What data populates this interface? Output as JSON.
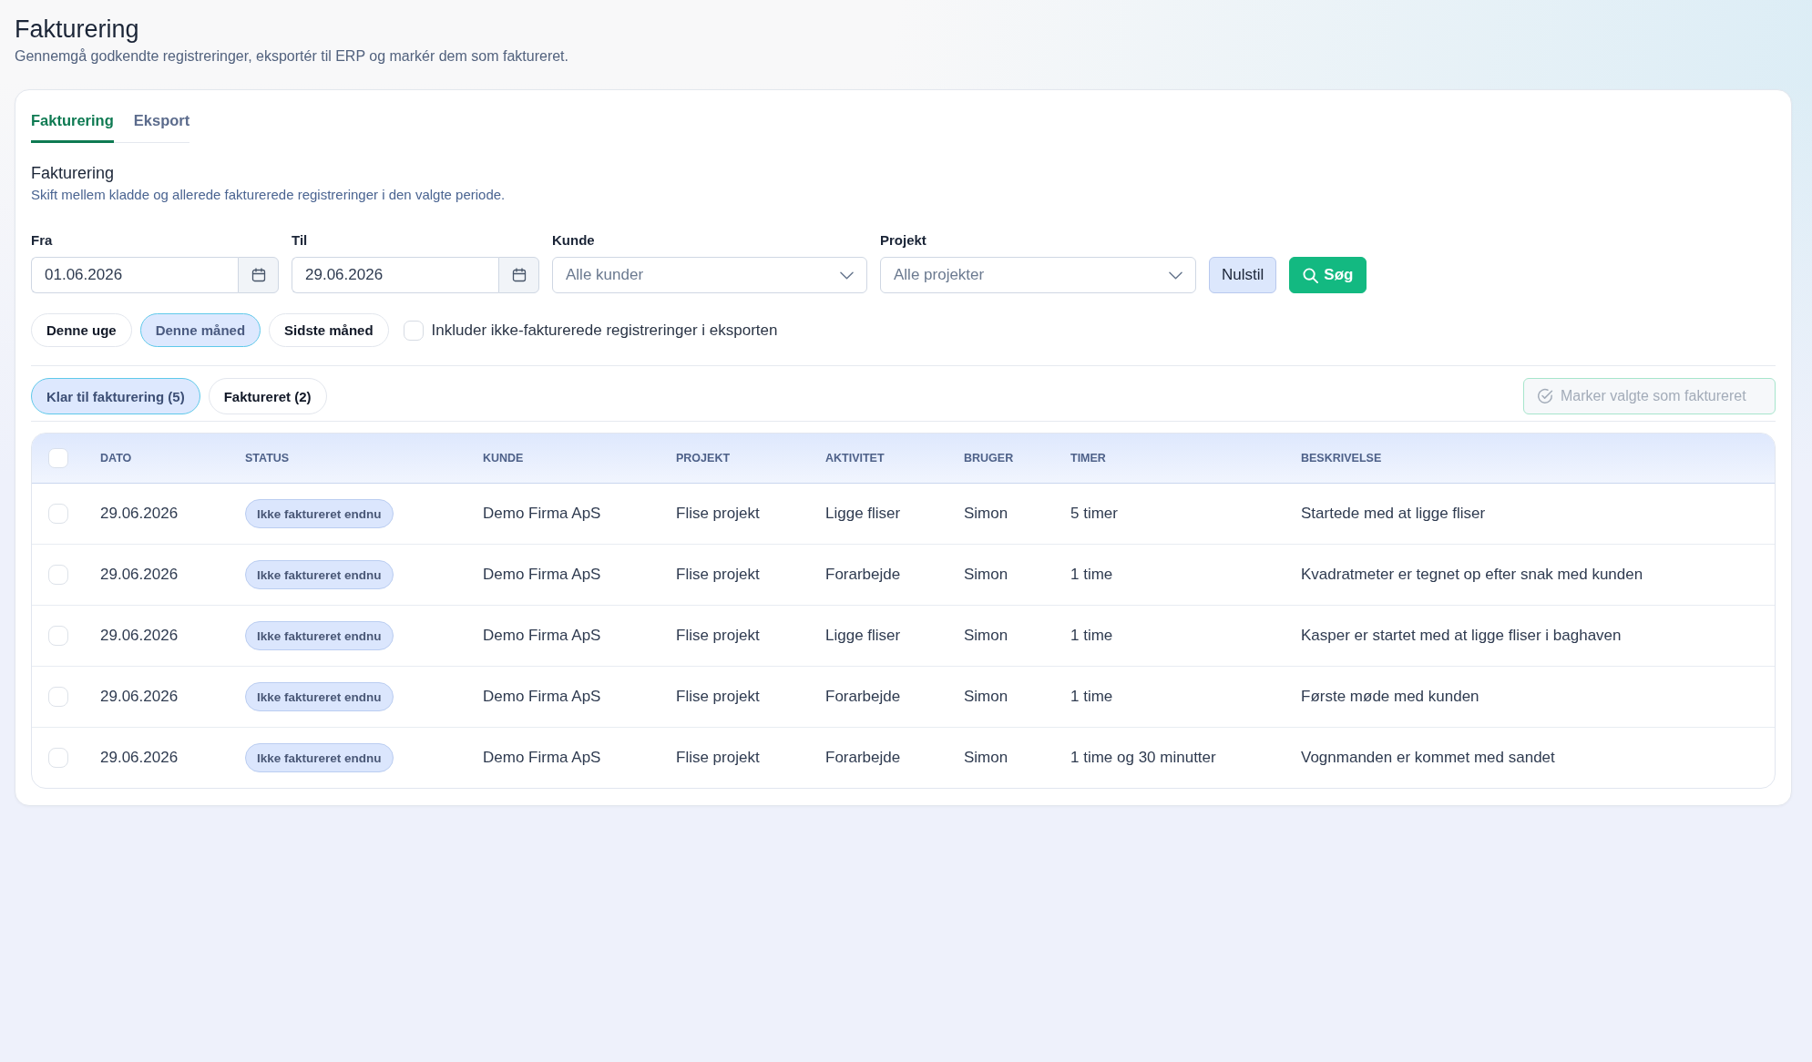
{
  "page": {
    "title": "Fakturering",
    "subtitle": "Gennemgå godkendte registreringer, eksportér til ERP og markér dem som faktureret."
  },
  "tabs": [
    {
      "label": "Fakturering",
      "selected": true
    },
    {
      "label": "Eksport",
      "selected": false
    }
  ],
  "section": {
    "title": "Fakturering",
    "subtitle": "Skift mellem kladde og allerede fakturerede registreringer i den valgte periode."
  },
  "filters": {
    "fields": [
      {
        "kind": "date",
        "label": "Fra",
        "value": "01.06.2026"
      },
      {
        "kind": "date",
        "label": "Til",
        "value": "29.06.2026"
      },
      {
        "kind": "select",
        "label": "Kunde",
        "placeholder": "Alle kunder"
      },
      {
        "kind": "select",
        "label": "Projekt",
        "placeholder": "Alle projekter"
      }
    ],
    "buttons": [
      {
        "kind": "reset",
        "label": "Nulstil"
      },
      {
        "kind": "search",
        "label": "Søg"
      }
    ]
  },
  "presets": [
    {
      "label": "Denne uge",
      "selected": false
    },
    {
      "label": "Denne måned",
      "selected": true
    },
    {
      "label": "Sidste måned",
      "selected": false
    }
  ],
  "include_option": {
    "label": "Inkluder ikke-fakturerede registreringer i eksporten",
    "checked": false
  },
  "status_tabs": [
    {
      "label": "Klar til fakturering (5)",
      "selected": true
    },
    {
      "label": "Faktureret (2)",
      "selected": false
    }
  ],
  "mark_button": {
    "label": "Marker valgte som faktureret",
    "disabled": true
  },
  "table": {
    "select_all": {
      "checked": false
    },
    "columns": [
      "DATO",
      "STATUS",
      "KUNDE",
      "PROJEKT",
      "AKTIVITET",
      "BRUGER",
      "TIMER",
      "BESKRIVELSE"
    ],
    "rows": [
      {
        "checked": false,
        "date": "29.06.2026",
        "status": "Ikke faktureret endnu",
        "customer": "Demo Firma ApS",
        "project": "Flise projekt",
        "activity": "Ligge fliser",
        "user": "Simon",
        "hours": "5 timer",
        "description": "Startede med at ligge fliser"
      },
      {
        "checked": false,
        "date": "29.06.2026",
        "status": "Ikke faktureret endnu",
        "customer": "Demo Firma ApS",
        "project": "Flise projekt",
        "activity": "Forarbejde",
        "user": "Simon",
        "hours": "1 time",
        "description": "Kvadratmeter er tegnet op efter snak med kunden"
      },
      {
        "checked": false,
        "date": "29.06.2026",
        "status": "Ikke faktureret endnu",
        "customer": "Demo Firma ApS",
        "project": "Flise projekt",
        "activity": "Ligge fliser",
        "user": "Simon",
        "hours": "1 time",
        "description": "Kasper er startet med at ligge fliser i baghaven"
      },
      {
        "checked": false,
        "date": "29.06.2026",
        "status": "Ikke faktureret endnu",
        "customer": "Demo Firma ApS",
        "project": "Flise projekt",
        "activity": "Forarbejde",
        "user": "Simon",
        "hours": "1 time",
        "description": "Første møde med kunden"
      },
      {
        "checked": false,
        "date": "29.06.2026",
        "status": "Ikke faktureret endnu",
        "customer": "Demo Firma ApS",
        "project": "Flise projekt",
        "activity": "Forarbejde",
        "user": "Simon",
        "hours": "1 time og 30 minutter",
        "description": "Vognmanden er kommet med sandet"
      }
    ]
  }
}
